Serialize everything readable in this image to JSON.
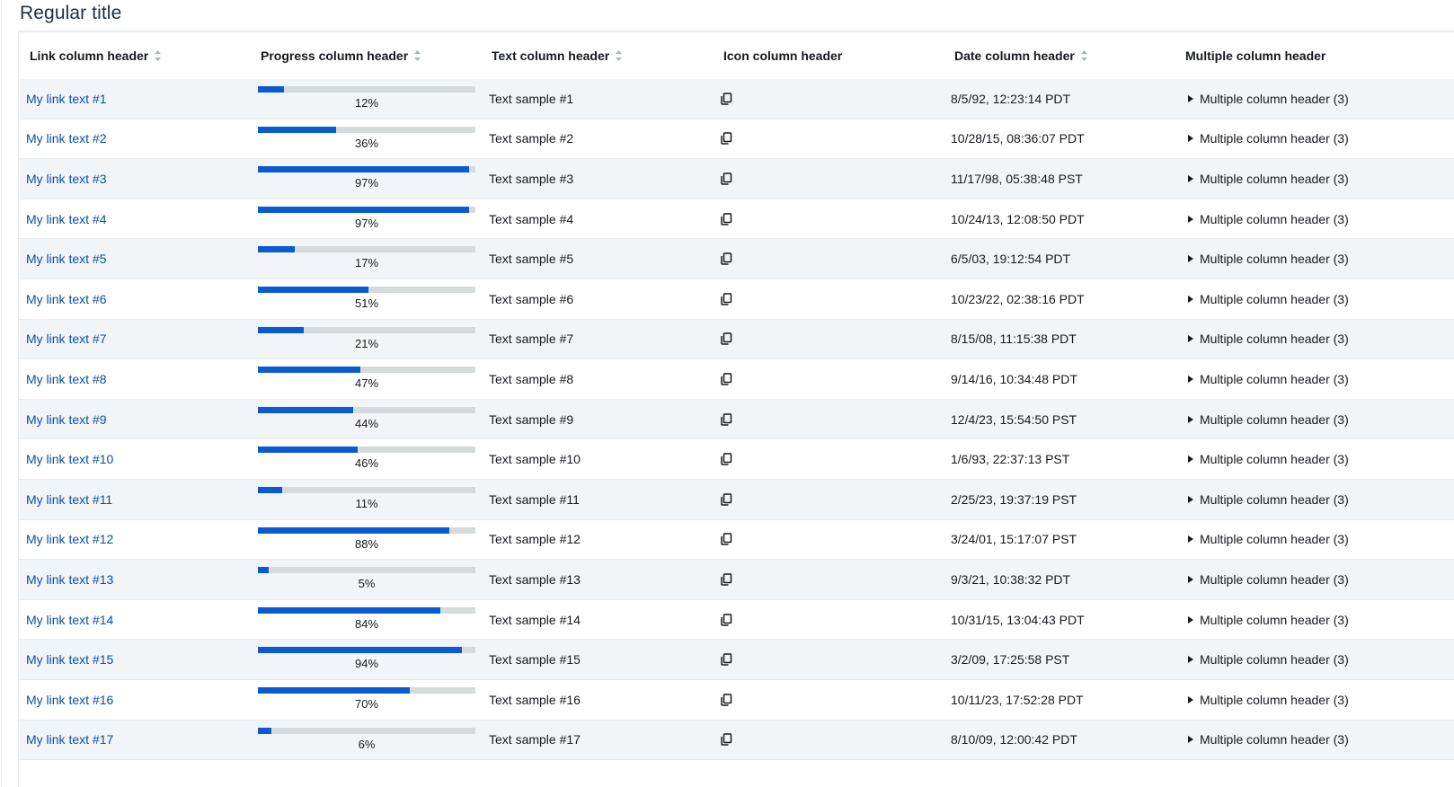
{
  "title": "Regular title",
  "colors": {
    "link": "#0b4fa0",
    "progress_fill": "#0a5bd1",
    "progress_track": "#d5dbdb",
    "row_stripe": "#f2f5f8"
  },
  "columns": {
    "link": "Link column header",
    "progress": "Progress column header",
    "text": "Text column header",
    "icon": "Icon column header",
    "date": "Date column header",
    "multiple": "Multiple column header"
  },
  "icons": {
    "sort": "sort-icon",
    "copy": "copy-icon",
    "expand": "caret-right-icon"
  },
  "rows": [
    {
      "link": "My link text #1",
      "progress": 12,
      "progress_label": "12%",
      "text": "Text sample #1",
      "date": "8/5/92, 12:23:14 PDT",
      "multiple": "Multiple column header (3)"
    },
    {
      "link": "My link text #2",
      "progress": 36,
      "progress_label": "36%",
      "text": "Text sample #2",
      "date": "10/28/15, 08:36:07 PDT",
      "multiple": "Multiple column header (3)"
    },
    {
      "link": "My link text #3",
      "progress": 97,
      "progress_label": "97%",
      "text": "Text sample #3",
      "date": "11/17/98, 05:38:48 PST",
      "multiple": "Multiple column header (3)"
    },
    {
      "link": "My link text #4",
      "progress": 97,
      "progress_label": "97%",
      "text": "Text sample #4",
      "date": "10/24/13, 12:08:50 PDT",
      "multiple": "Multiple column header (3)"
    },
    {
      "link": "My link text #5",
      "progress": 17,
      "progress_label": "17%",
      "text": "Text sample #5",
      "date": "6/5/03, 19:12:54 PDT",
      "multiple": "Multiple column header (3)"
    },
    {
      "link": "My link text #6",
      "progress": 51,
      "progress_label": "51%",
      "text": "Text sample #6",
      "date": "10/23/22, 02:38:16 PDT",
      "multiple": "Multiple column header (3)"
    },
    {
      "link": "My link text #7",
      "progress": 21,
      "progress_label": "21%",
      "text": "Text sample #7",
      "date": "8/15/08, 11:15:38 PDT",
      "multiple": "Multiple column header (3)"
    },
    {
      "link": "My link text #8",
      "progress": 47,
      "progress_label": "47%",
      "text": "Text sample #8",
      "date": "9/14/16, 10:34:48 PDT",
      "multiple": "Multiple column header (3)"
    },
    {
      "link": "My link text #9",
      "progress": 44,
      "progress_label": "44%",
      "text": "Text sample #9",
      "date": "12/4/23, 15:54:50 PST",
      "multiple": "Multiple column header (3)"
    },
    {
      "link": "My link text #10",
      "progress": 46,
      "progress_label": "46%",
      "text": "Text sample #10",
      "date": "1/6/93, 22:37:13 PST",
      "multiple": "Multiple column header (3)"
    },
    {
      "link": "My link text #11",
      "progress": 11,
      "progress_label": "11%",
      "text": "Text sample #11",
      "date": "2/25/23, 19:37:19 PST",
      "multiple": "Multiple column header (3)"
    },
    {
      "link": "My link text #12",
      "progress": 88,
      "progress_label": "88%",
      "text": "Text sample #12",
      "date": "3/24/01, 15:17:07 PST",
      "multiple": "Multiple column header (3)"
    },
    {
      "link": "My link text #13",
      "progress": 5,
      "progress_label": "5%",
      "text": "Text sample #13",
      "date": "9/3/21, 10:38:32 PDT",
      "multiple": "Multiple column header (3)"
    },
    {
      "link": "My link text #14",
      "progress": 84,
      "progress_label": "84%",
      "text": "Text sample #14",
      "date": "10/31/15, 13:04:43 PDT",
      "multiple": "Multiple column header (3)"
    },
    {
      "link": "My link text #15",
      "progress": 94,
      "progress_label": "94%",
      "text": "Text sample #15",
      "date": "3/2/09, 17:25:58 PST",
      "multiple": "Multiple column header (3)"
    },
    {
      "link": "My link text #16",
      "progress": 70,
      "progress_label": "70%",
      "text": "Text sample #16",
      "date": "10/11/23, 17:52:28 PDT",
      "multiple": "Multiple column header (3)"
    },
    {
      "link": "My link text #17",
      "progress": 6,
      "progress_label": "6%",
      "text": "Text sample #17",
      "date": "8/10/09, 12:00:42 PDT",
      "multiple": "Multiple column header (3)"
    }
  ]
}
